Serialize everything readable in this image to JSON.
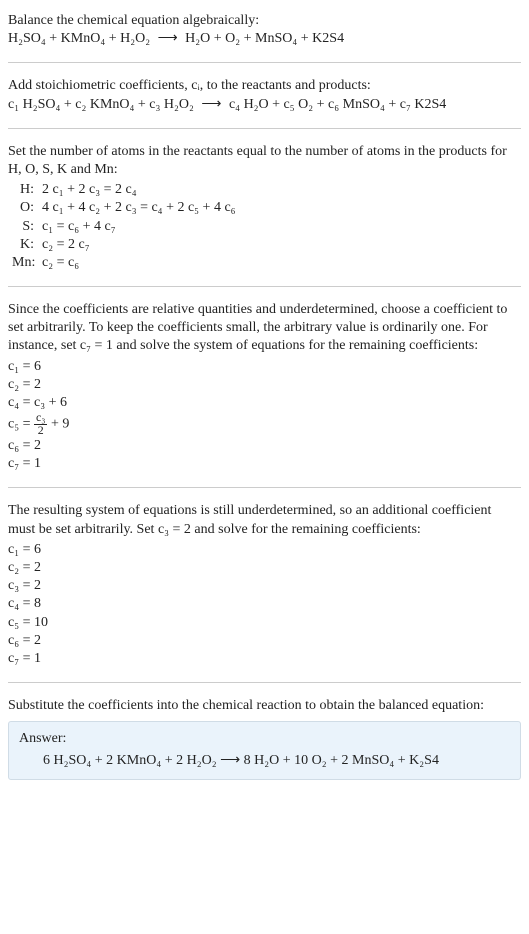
{
  "intro_line": "Balance the chemical equation algebraically:",
  "reaction_plain": {
    "lhs": "H₂SO₄ + KMnO₄ + H₂O₂",
    "arrow": "⟶",
    "rhs": "H₂O + O₂ + MnSO₄ + K2S4"
  },
  "stoich_line": "Add stoichiometric coefficients, cᵢ, to the reactants and products:",
  "reaction_c": {
    "lhs": "c₁ H₂SO₄ + c₂ KMnO₄ + c₃ H₂O₂",
    "arrow": "⟶",
    "rhs": "c₄ H₂O + c₅ O₂ + c₆ MnSO₄ + c₇ K2S4"
  },
  "atoms_intro": "Set the number of atoms in the reactants equal to the number of atoms in the products for H, O, S, K and Mn:",
  "atom_equations": [
    {
      "el": "H:",
      "eq": "2 c₁ + 2 c₃ = 2 c₄"
    },
    {
      "el": "O:",
      "eq": "4 c₁ + 4 c₂ + 2 c₃ = c₄ + 2 c₅ + 4 c₆"
    },
    {
      "el": "S:",
      "eq": "c₁ = c₆ + 4 c₇"
    },
    {
      "el": "K:",
      "eq": "c₂ = 2 c₇"
    },
    {
      "el": "Mn:",
      "eq": "c₂ = c₆"
    }
  ],
  "underdet1": "Since the coefficients are relative quantities and underdetermined, choose a coefficient to set arbitrarily. To keep the coefficients small, the arbitrary value is ordinarily one. For instance, set c₇ = 1 and solve the system of equations for the remaining coefficients:",
  "solns1": [
    "c₁ = 6",
    "c₂ = 2",
    "c₄ = c₃ + 6",
    "__FRAC__",
    "c₆ = 2",
    "c₇ = 1"
  ],
  "frac_line": {
    "prefix": "c₅ = ",
    "num": "c₃",
    "den": "2",
    "suffix": " + 9"
  },
  "underdet2": "The resulting system of equations is still underdetermined, so an additional coefficient must be set arbitrarily. Set c₃ = 2 and solve for the remaining coefficients:",
  "solns2": [
    "c₁ = 6",
    "c₂ = 2",
    "c₃ = 2",
    "c₄ = 8",
    "c₅ = 10",
    "c₆ = 2",
    "c₇ = 1"
  ],
  "subst_line": "Substitute the coefficients into the chemical reaction to obtain the balanced equation:",
  "answer_label": "Answer:",
  "answer_eq": "6 H₂SO₄ + 2 KMnO₄ + 2 H₂O₂  ⟶  8 H₂O + 10 O₂ + 2 MnSO₄ + K₂S4"
}
